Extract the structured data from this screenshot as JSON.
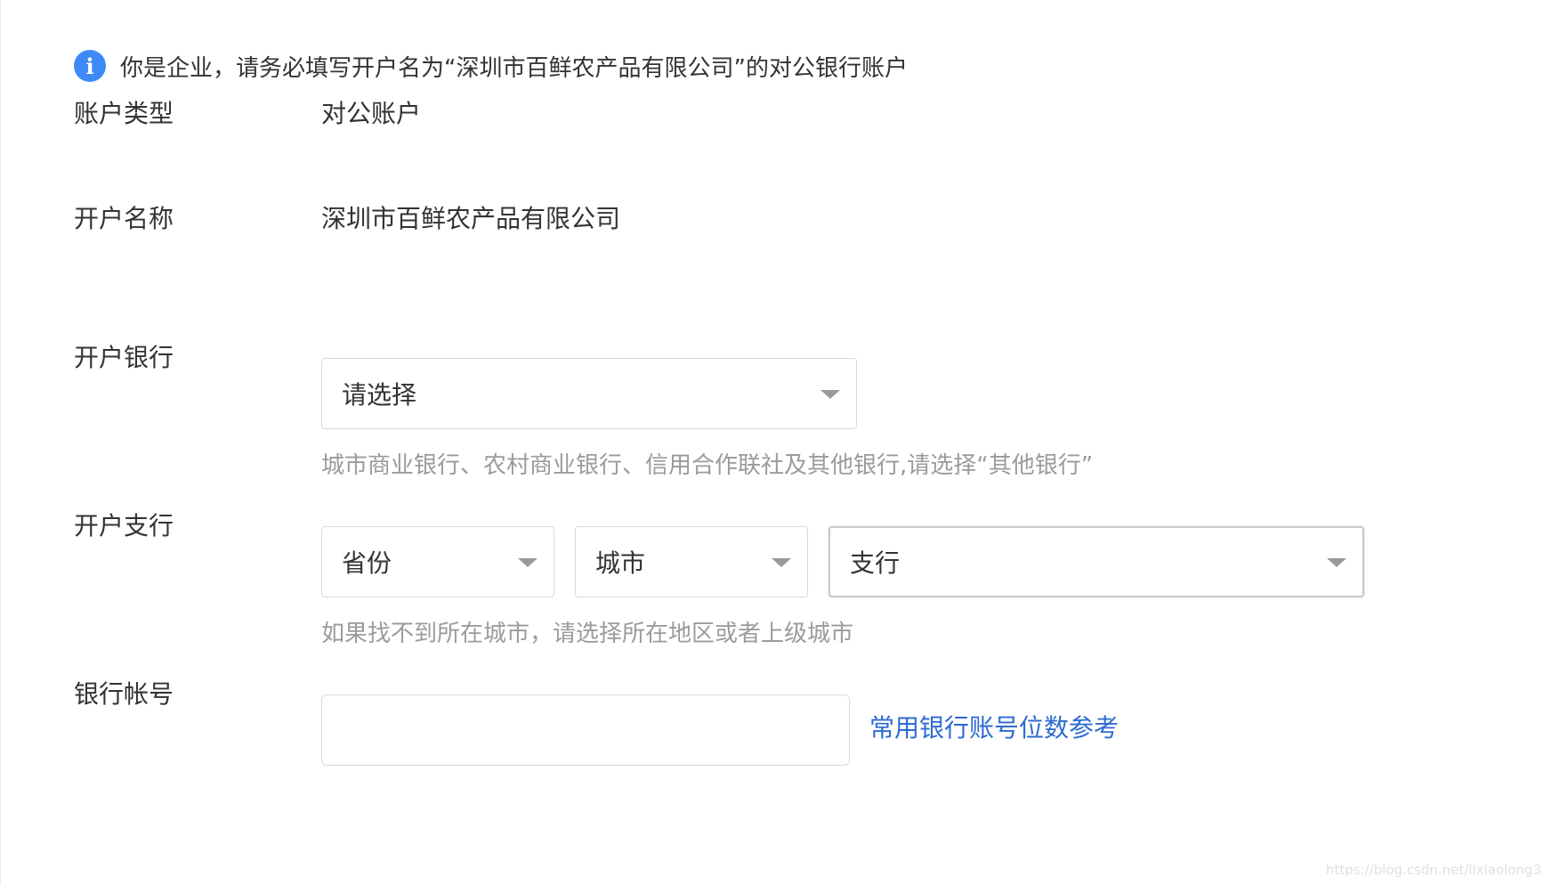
{
  "notice": {
    "icon": "info-icon",
    "text": "你是企业，请务必填写开户名为“深圳市百鲜农产品有限公司”的对公银行账户"
  },
  "account_type": {
    "label": "账户类型",
    "value": "对公账户"
  },
  "account_name": {
    "label": "开户名称",
    "value": "深圳市百鲜农产品有限公司"
  },
  "bank": {
    "label": "开户银行",
    "select_value": "请选择",
    "hint": "城市商业银行、农村商业银行、信用合作联社及其他银行,请选择“其他银行”"
  },
  "branch": {
    "label": "开户支行",
    "province": "省份",
    "city": "城市",
    "branch": "支行",
    "hint": "如果找不到所在城市，请选择所在地区或者上级城市"
  },
  "account_number": {
    "label": "银行帐号",
    "value": "",
    "link": "常用银行账号位数参考"
  },
  "watermark": "https://blog.csdn.net/lixiaolong3",
  "colors": {
    "info_icon": "#3d8af7",
    "link": "#2d6bd0",
    "hint": "#9b9b9b",
    "border": "#d9d9d9"
  }
}
